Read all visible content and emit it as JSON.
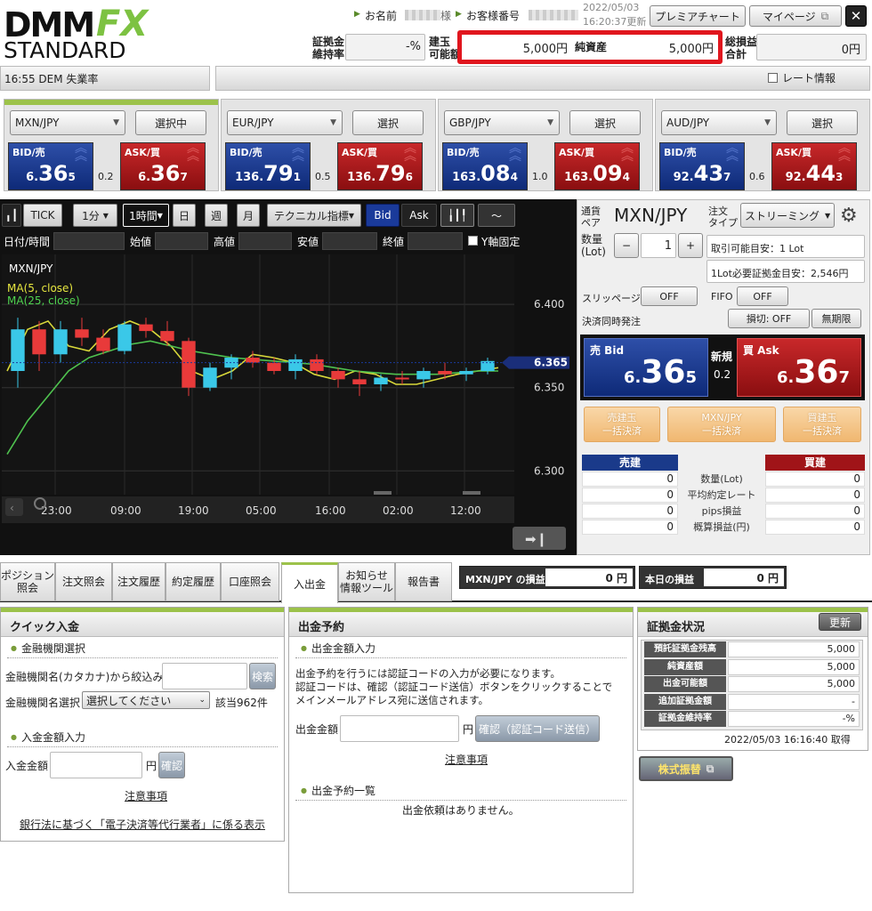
{
  "header": {
    "logo_top": "DMM",
    "logo_fx": "FX",
    "logo_bottom": "STANDARD",
    "name_label": "お名前",
    "name_suffix": "様",
    "customer_no_label": "お客様番号",
    "date": "2022/05/03",
    "time_updated": "16:20:37更新",
    "premium_chart": "プレミアチャート",
    "my_page": "マイページ",
    "close": "✕",
    "margin_rate_label": "証拠金\n維持率",
    "margin_rate_value": "-%",
    "available_label": "建玉\n可能額",
    "available_value": "5,000円",
    "net_assets_label": "純資産",
    "net_assets_value": "5,000円",
    "total_pl_label": "総損益\n合計",
    "total_pl_value": "0円",
    "news": "16:55 DEM 失業率",
    "rate_info": "レート情報"
  },
  "quotes": [
    {
      "pair": "MXN/JPY",
      "button": "選択中",
      "bid_label": "BID/売",
      "ask_label": "ASK/買",
      "bid_pre": "6.",
      "bid_main": "36",
      "bid_sub": "5",
      "ask_pre": "6.",
      "ask_main": "36",
      "ask_sub": "7",
      "spread": "0.2"
    },
    {
      "pair": "EUR/JPY",
      "button": "選択",
      "bid_label": "BID/売",
      "ask_label": "ASK/買",
      "bid_pre": "136.",
      "bid_main": "79",
      "bid_sub": "1",
      "ask_pre": "136.",
      "ask_main": "79",
      "ask_sub": "6",
      "spread": "0.5"
    },
    {
      "pair": "GBP/JPY",
      "button": "選択",
      "bid_label": "BID/売",
      "ask_label": "ASK/買",
      "bid_pre": "163.",
      "bid_main": "08",
      "bid_sub": "4",
      "ask_pre": "163.",
      "ask_main": "09",
      "ask_sub": "4",
      "spread": "1.0"
    },
    {
      "pair": "AUD/JPY",
      "button": "選択",
      "bid_label": "BID/売",
      "ask_label": "ASK/買",
      "bid_pre": "92.",
      "bid_main": "43",
      "bid_sub": "7",
      "ask_pre": "92.",
      "ask_main": "44",
      "ask_sub": "3",
      "spread": "0.6"
    }
  ],
  "chart_toolbar": {
    "tick": "TICK",
    "min1": "1分",
    "hour1": "1時間",
    "day": "日",
    "week": "週",
    "month": "月",
    "tech": "テクニカル指標",
    "bid": "Bid",
    "ask": "Ask"
  },
  "ohlc": {
    "datetime": "日付/時間",
    "open": "始値",
    "high": "高値",
    "low": "安値",
    "close": "終値",
    "yfix": "Y軸固定"
  },
  "chart_data": {
    "type": "line",
    "title": "MXN/JPY",
    "legend": [
      "MA(5, close)",
      "MA(25, close)"
    ],
    "y_ticks": [
      "6.400",
      "6.350",
      "6.300"
    ],
    "y_range": [
      6.29,
      6.43
    ],
    "current_price": "6.365",
    "x_ticks": [
      "23:00",
      "09:00",
      "19:00",
      "05:00",
      "16:00",
      "02:00",
      "12:00"
    ],
    "series": [
      {
        "name": "MA(5, close)",
        "color": "#d8d83a",
        "values": [
          6.36,
          6.385,
          6.39,
          6.375,
          6.372,
          6.385,
          6.39,
          6.385,
          6.375,
          6.36,
          6.355,
          6.36,
          6.37,
          6.368,
          6.365,
          6.358,
          6.355,
          6.36,
          6.358,
          6.352,
          6.352,
          6.355,
          6.358,
          6.36,
          6.362
        ]
      },
      {
        "name": "MA(25, close)",
        "color": "#4fc24f",
        "values": [
          6.31,
          6.33,
          6.345,
          6.36,
          6.368,
          6.372,
          6.376,
          6.378,
          6.375,
          6.372,
          6.37,
          6.368,
          6.367,
          6.366,
          6.365,
          6.364,
          6.362,
          6.36,
          6.359,
          6.358,
          6.358,
          6.358,
          6.359,
          6.36,
          6.36
        ]
      }
    ],
    "candles": [
      [
        6.36,
        6.392,
        6.35,
        6.385
      ],
      [
        6.385,
        6.39,
        6.36,
        6.37
      ],
      [
        6.37,
        6.39,
        6.365,
        6.385
      ],
      [
        6.385,
        6.392,
        6.375,
        6.38
      ],
      [
        6.38,
        6.385,
        6.37,
        6.372
      ],
      [
        6.372,
        6.39,
        6.37,
        6.388
      ],
      [
        6.388,
        6.392,
        6.38,
        6.384
      ],
      [
        6.384,
        6.39,
        6.375,
        6.378
      ],
      [
        6.378,
        6.38,
        6.345,
        6.35
      ],
      [
        6.35,
        6.365,
        6.348,
        6.362
      ],
      [
        6.362,
        6.37,
        6.355,
        6.368
      ],
      [
        6.368,
        6.372,
        6.362,
        6.365
      ],
      [
        6.365,
        6.368,
        6.358,
        6.36
      ],
      [
        6.36,
        6.37,
        6.355,
        6.367
      ],
      [
        6.367,
        6.37,
        6.358,
        6.36
      ],
      [
        6.36,
        6.362,
        6.35,
        6.355
      ],
      [
        6.355,
        6.36,
        6.345,
        6.352
      ],
      [
        6.352,
        6.358,
        6.348,
        6.356
      ],
      [
        6.356,
        6.36,
        6.352,
        6.355
      ],
      [
        6.355,
        6.362,
        6.35,
        6.36
      ],
      [
        6.36,
        6.365,
        6.355,
        6.358
      ],
      [
        6.358,
        6.362,
        6.354,
        6.36
      ],
      [
        6.36,
        6.368,
        6.358,
        6.366
      ]
    ]
  },
  "order": {
    "pair_label": "通貨\nペア",
    "pair": "MXN/JPY",
    "type_label": "注文\nタイプ",
    "type": "ストリーミング",
    "qty_label": "数量\n(Lot)",
    "minus": "−",
    "qty": "1",
    "plus": "+",
    "tradable": "取引可能目安：1 Lot",
    "margin_needed": "1Lot必要証拠金目安：2,546円",
    "slippage_label": "スリッページ",
    "slippage": "OFF",
    "fifo_label": "FIFO",
    "fifo": "OFF",
    "simul_label": "決済同時発注",
    "stop": "損切: OFF",
    "unlimited": "無期限",
    "sell_label": "売 Bid",
    "sell_pre": "6.",
    "sell_main": "36",
    "sell_sub": "5",
    "buy_label": "買 Ask",
    "buy_pre": "6.",
    "buy_main": "36",
    "buy_sub": "7",
    "new_label": "新規",
    "spread": "0.2",
    "sell_close": "売建玉\n一括決済",
    "pair_close": "MXN/JPY\n一括決済",
    "buy_close": "買建玉\n一括決済",
    "sell_head": "売建",
    "buy_head": "買建",
    "rows": [
      {
        "sell": "0",
        "label": "数量(Lot)",
        "buy": "0"
      },
      {
        "sell": "0",
        "label": "平均約定レート",
        "buy": "0"
      },
      {
        "sell": "0",
        "label": "pips損益",
        "buy": "0"
      },
      {
        "sell": "0",
        "label": "概算損益(円)",
        "buy": "0"
      }
    ]
  },
  "tabs": [
    "ポジション\n照会",
    "注文照会",
    "注文履歴",
    "約定履歴",
    "口座照会",
    "入出金",
    "お知らせ\n情報ツール",
    "報告書"
  ],
  "pl": {
    "pair_label": "MXN/JPY の損益",
    "pair_value": "0 円",
    "today_label": "本日の損益",
    "today_value": "0 円"
  },
  "quick_deposit": {
    "title": "クイック入金",
    "bank_section": "金融機関選択",
    "kana_label": "金融機関名(カタカナ)から絞込み",
    "search": "検索",
    "bank_select_label": "金融機関名選択",
    "bank_select": "選択してください",
    "count": "該当962件",
    "amount_section": "入金金額入力",
    "amount_label": "入金金額",
    "yen": "円",
    "confirm": "確認",
    "notes": "注意事項",
    "law": "銀行法に基づく「電子決済等代行業者」に係る表示"
  },
  "withdraw": {
    "title": "出金予約",
    "amount_section": "出金金額入力",
    "desc1": "出金予約を行うには認証コードの入力が必要になります。",
    "desc2": "認証コードは、確認（認証コード送信）ボタンをクリックすることで",
    "desc3": "メインメールアドレス宛に送信されます。",
    "amount_label": "出金金額",
    "yen": "円",
    "confirm": "確認（認証コード送信）",
    "notes": "注意事項",
    "list_section": "出金予約一覧",
    "empty": "出金依頼はありません。"
  },
  "margin": {
    "title": "証拠金状況",
    "refresh": "更新",
    "rows": [
      {
        "k": "預託証拠金残高",
        "v": "5,000"
      },
      {
        "k": "純資産額",
        "v": "5,000"
      },
      {
        "k": "出金可能額",
        "v": "5,000"
      },
      {
        "k": "追加証拠金額",
        "v": "-"
      },
      {
        "k": "証拠金維持率",
        "v": "-%"
      }
    ],
    "timestamp": "2022/05/03 16:16:40 取得",
    "stock_transfer": "株式振替"
  }
}
